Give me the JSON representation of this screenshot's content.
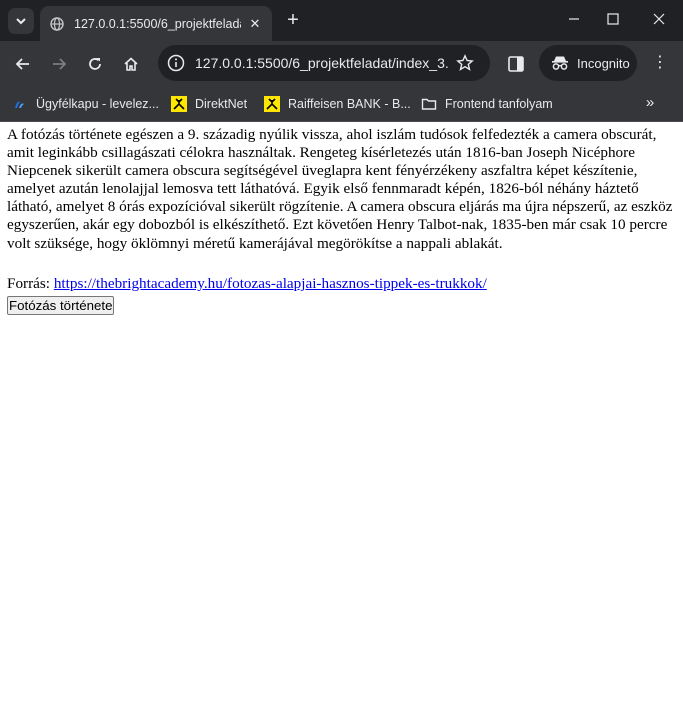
{
  "browser": {
    "tab_title": "127.0.0.1:5500/6_projektfeladat/",
    "url": "127.0.0.1:5500/6_projektfeladat/index_3....",
    "profile_label": "Incognito"
  },
  "bookmarks": [
    {
      "label": "Ügyfélkapu - levelez...",
      "icon": "ugyfelkapu-icon"
    },
    {
      "label": "DirektNet",
      "icon": "raiffeisen-icon"
    },
    {
      "label": "Raiffeisen BANK - B...",
      "icon": "raiffeisen-icon"
    },
    {
      "label": "Frontend tanfolyam",
      "icon": "folder-icon"
    }
  ],
  "page": {
    "paragraph": "A fotózás története egészen a 9. századig nyúlik vissza, ahol iszlám tudósok felfedezték a camera obscurát, amit leginkább csillagászati célokra használtak. Rengeteg kísérletezés után 1816-ban Joseph Nicéphore Niepcenek sikerült camera obscura segítségével üveglapra kent fényérzékeny aszfaltra képet készítenie, amelyet azután lenolajjal lemosva tett láthatóvá. Egyik első fennmaradt képén, 1826-ból néhány háztető látható, amelyet 8 órás expozícióval sikerült rögzítenie. A camera obscura eljárás ma újra népszerű, az eszköz egyszerűen, akár egy dobozból is elkészíthető. Ezt követően Henry Talbot-nak, 1835-ben már csak 10 percre volt szüksége, hogy öklömnyi méretű kamerájával megörökítse a nappali ablakát.",
    "source_label": "Forrás:",
    "source_link": "https://thebrightacademy.hu/fotozas-alapjai-hasznos-tippek-es-trukkok/",
    "button_label": "Fotózás története"
  },
  "colors": {
    "chrome_dark": "#202124",
    "chrome_toolbar": "#35363a",
    "link": "#0000ee"
  }
}
